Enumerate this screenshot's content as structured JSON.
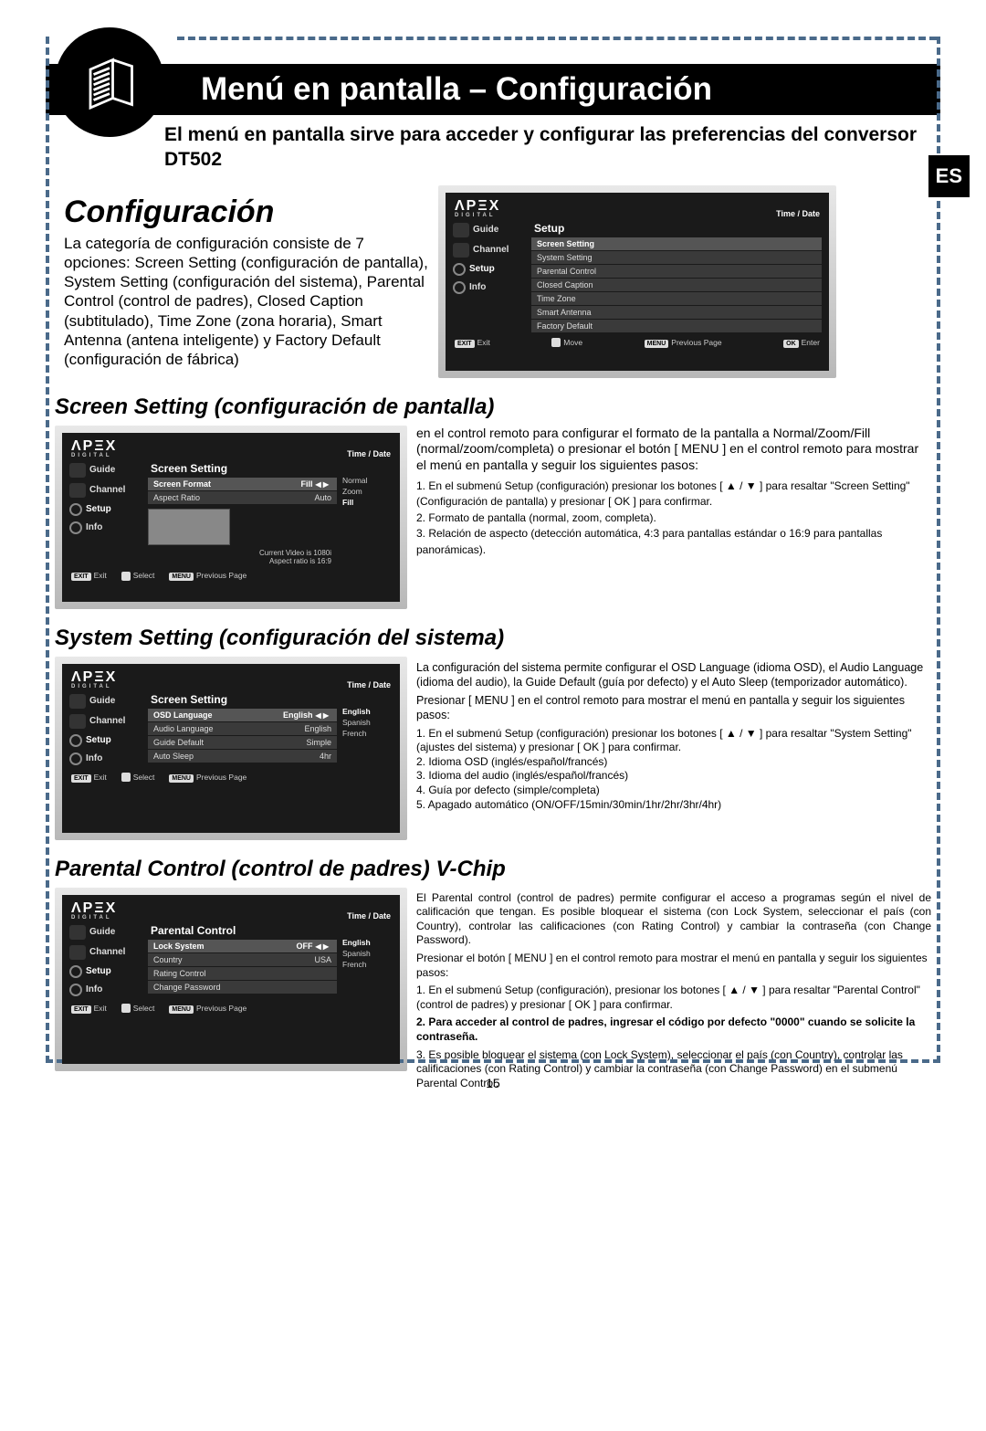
{
  "page_number": "15",
  "lang_badge": "ES",
  "header": {
    "title": "Menú en pantalla – Configuración",
    "subtitle": "El menú en pantalla sirve para acceder y configurar las preferencias del conversor DT502"
  },
  "config": {
    "heading": "Configuración",
    "intro": "La categoría de configuración consiste de 7 opciones: Screen Setting (configuración de pantalla), System Setting (configuración del sistema), Parental Control (control de padres), Closed Caption (subtitulado), Time Zone (zona horaria), Smart Antenna (antena inteligente) y Factory Default (configuración de fábrica)"
  },
  "osd_common": {
    "logo": "ΛPΞX",
    "logo_sub": "DIGITAL",
    "time_date": "Time / Date",
    "side": [
      "Guide",
      "Channel",
      "Setup",
      "Info"
    ],
    "footer": {
      "exit_btn": "EXIT",
      "exit": "Exit",
      "move": "Move",
      "select": "Select",
      "menu_btn": "MENU",
      "prev": "Previous Page",
      "ok_btn": "OK",
      "enter": "Enter"
    }
  },
  "osd_setup": {
    "panel_title": "Setup",
    "items": [
      "Screen Setting",
      "System Setting",
      "Parental Control",
      "Closed Caption",
      "Time Zone",
      "Smart Antenna",
      "Factory Default"
    ]
  },
  "screen": {
    "heading": "Screen Setting (configuración de pantalla)",
    "text1": "en el control remoto para configurar el formato de la pantalla a Normal/Zoom/Fill (normal/zoom/completa) o presionar el botón [ MENU ] en el control remoto para mostrar el menú en pantalla y seguir los siguientes pasos:",
    "steps": "1. En el submenú Setup (configuración) presionar los botones [ ▲ / ▼ ] para resaltar \"Screen Setting\" (Configuración de pantalla) y presionar [ OK ] para confirmar.\n2. Formato de pantalla (normal, zoom, completa).\n3. Relación de aspecto (detección automática, 4:3 para pantallas estándar o 16:9 para pantallas panorámicas).",
    "osd": {
      "panel_title": "Screen Setting",
      "rows": [
        {
          "k": "Screen Format",
          "v": "Fill"
        },
        {
          "k": "Aspect Ratio",
          "v": "Auto"
        }
      ],
      "opts": [
        "Normal",
        "Zoom",
        "Fill"
      ],
      "note1": "Current Video is 1080i",
      "note2": "Aspect ratio is 16:9"
    }
  },
  "system": {
    "heading": "System Setting (configuración del sistema)",
    "text1": "La configuración del sistema permite configurar el OSD Language (idioma OSD), el Audio Language (idioma del audio), la Guide Default (guía por defecto) y el Auto Sleep (temporizador automático).",
    "text2": "Presionar [ MENU ] en el control remoto para mostrar el menú en pantalla y seguir los siguientes pasos:",
    "steps": "1. En el submenú Setup (configuración) presionar los botones [ ▲ / ▼ ] para resaltar \"System Setting\" (ajustes del sistema) y presionar [ OK ] para confirmar.\n2. Idioma OSD (inglés/español/francés)\n3. Idioma del audio (inglés/español/francés)\n4. Guía por defecto (simple/completa)\n5. Apagado automático (ON/OFF/15min/30min/1hr/2hr/3hr/4hr)",
    "osd": {
      "panel_title": "Screen Setting",
      "rows": [
        {
          "k": "OSD Language",
          "v": "English"
        },
        {
          "k": "Audio Language",
          "v": "English"
        },
        {
          "k": "Guide Default",
          "v": "Simple"
        },
        {
          "k": "Auto Sleep",
          "v": "4hr"
        }
      ],
      "opts": [
        "English",
        "Spanish",
        "French"
      ]
    }
  },
  "parental": {
    "heading": "Parental Control (control de padres) V-Chip",
    "text1": "El Parental control (control de padres) permite configurar el acceso a programas según el nivel de calificación que tengan. Es posible bloquear el sistema (con Lock System, seleccionar el país (con Country), controlar las calificaciones (con Rating Control) y cambiar la contraseña (con Change Password).",
    "text2": "Presionar el botón [ MENU ] en el control remoto para mostrar el menú en pantalla y seguir los siguientes pasos:",
    "step1": "1. En el submenú Setup (configuración), presionar los botones [ ▲ / ▼ ] para resaltar \"Parental Control\" (control de padres) y presionar [ OK ] para confirmar.",
    "step2": "2. Para acceder al control de padres, ingresar el código por defecto \"0000\" cuando se solicite la contraseña.",
    "step3": "3. Es posible bloquear el sistema (con Lock System), seleccionar el país (con Country), controlar las calificaciones (con Rating Control) y cambiar la contraseña (con Change Password) en el submenú Parental Control.",
    "osd": {
      "panel_title": "Parental Control",
      "rows": [
        {
          "k": "Lock System",
          "v": "OFF"
        },
        {
          "k": "Country",
          "v": "USA"
        },
        {
          "k": "Rating Control",
          "v": ""
        },
        {
          "k": "Change Password",
          "v": ""
        }
      ],
      "opts": [
        "English",
        "Spanish",
        "French"
      ]
    }
  }
}
